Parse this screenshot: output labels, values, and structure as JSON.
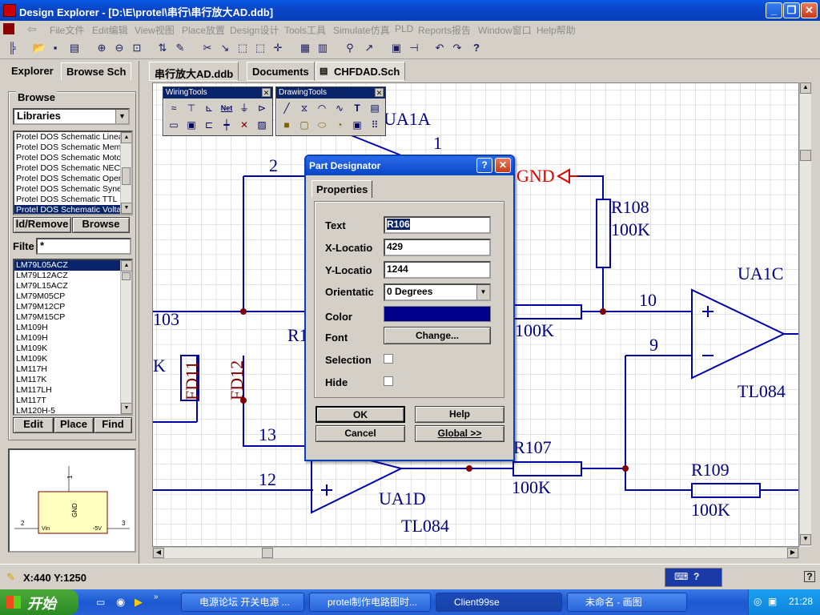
{
  "window": {
    "title": "Design Explorer - [D:\\E\\protel\\串行\\串行放大AD.ddb]",
    "controls": {
      "minimize": "_",
      "restore": "❐",
      "close": "✕"
    }
  },
  "menubar": {
    "items": [
      "File文件",
      "Edit编辑",
      "View视图",
      "Place放置",
      "Design设计",
      "Tools工具",
      "Simulate仿真",
      "PLD",
      "Reports报告",
      "Window窗口",
      "Help帮助"
    ]
  },
  "left_panel": {
    "tabs": [
      "Explorer",
      "Browse Sch"
    ],
    "browse_label": "Browse",
    "browse_combo_value": "Libraries",
    "libraries": [
      "Protel DOS Schematic Linear",
      "Protel DOS Schematic Memory",
      "Protel DOS Schematic Motorola",
      "Protel DOS Schematic NEC",
      "Protel DOS Schematic Operational",
      "Protel DOS Schematic Synertek",
      "Protel DOS Schematic TTL",
      "Protel DOS Schematic Voltage"
    ],
    "add_remove_label": "ld/Remove",
    "browse_button": "Browse",
    "filter_label": "Filte",
    "filter_value": "*",
    "components": [
      "LM79L05ACZ",
      "LM79L12ACZ",
      "LM79L15ACZ",
      "LM79M05CP",
      "LM79M12CP",
      "LM79M15CP",
      "LM109H",
      "LM109H",
      "LM109K",
      "LM109K",
      "LM117H",
      "LM117K",
      "LM117LH",
      "LM117T",
      "LM120H-5"
    ],
    "edit_button": "Edit",
    "place_button": "Place",
    "find_button": "Find",
    "preview": {
      "pin1": "1",
      "pin2": "2",
      "pin3": "3",
      "gnd": "GND",
      "vin": "Vin",
      "vout": "-5V"
    }
  },
  "doc_tabs": [
    "串行放大AD.ddb",
    "Documents",
    "CHFDAD.Sch"
  ],
  "wiring_tools": {
    "title": "WiringTools"
  },
  "drawing_tools": {
    "title": "DrawingTools"
  },
  "schematic": {
    "labels": {
      "ua1a": "UA1A",
      "ua1c": "UA1C",
      "ua1d": "UA1D",
      "tl084_c": "TL084",
      "tl084_d": "TL084",
      "r108": "R108",
      "r108_val": "100K",
      "r107": "R107",
      "r107_val": "100K",
      "r109": "R109",
      "r109_val": "100K",
      "r106_val": "100K",
      "gnd": "GND",
      "fd11": "FD11",
      "fd12": "FD12",
      "pin1": "1",
      "pin2": "2",
      "pin9": "9",
      "pin10": "10",
      "pin12": "12",
      "pin13": "13",
      "r103": "103",
      "k": "K",
      "r1x": "R1"
    }
  },
  "dialog": {
    "title": "Part Designator",
    "tab": "Properties",
    "text_label": "Text",
    "text_value": "R106",
    "xloc_label": "X-Locatio",
    "xloc_value": "429",
    "yloc_label": "Y-Locatio",
    "yloc_value": "1244",
    "orient_label": "Orientatic",
    "orient_value": "0 Degrees",
    "color_label": "Color",
    "color_value": "#00008b",
    "font_label": "Font",
    "font_button": "Change...",
    "selection_label": "Selection",
    "hide_label": "Hide",
    "ok": "OK",
    "help": "Help",
    "cancel": "Cancel",
    "global": "Global >>"
  },
  "statusbar": {
    "coords": "X:440 Y:1250"
  },
  "taskbar": {
    "start": "开始",
    "items": [
      "电源论坛 开关电源 ...",
      "protel制作电路图时...",
      "Client99se",
      "未命名 - 画图"
    ],
    "clock": "21:28"
  },
  "colors": {
    "wire": "#0000a8",
    "component": "#000080",
    "junction": "#800000",
    "gnd": "#e00000",
    "text_red": "#800000"
  }
}
